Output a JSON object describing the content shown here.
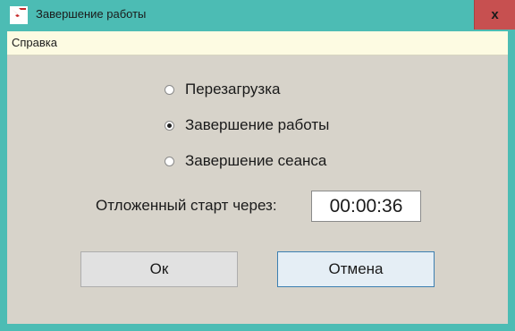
{
  "window": {
    "title": "Завершение работы",
    "close_label": "x",
    "app_icon": "shutdown-app-icon"
  },
  "menu": {
    "items": [
      {
        "label": "Справка"
      }
    ]
  },
  "options": [
    {
      "label": "Перезагрузка",
      "checked": false
    },
    {
      "label": "Завершение работы",
      "checked": true
    },
    {
      "label": "Завершение сеанса",
      "checked": false
    }
  ],
  "delay": {
    "label": "Отложенный старт через:",
    "value": "00:00:36"
  },
  "buttons": {
    "ok": "Ок",
    "cancel": "Отмена"
  },
  "colors": {
    "frame": "#4cbcb4",
    "close_button": "#c75050",
    "menubar": "#fdfbe2",
    "client": "#d7d3ca"
  }
}
